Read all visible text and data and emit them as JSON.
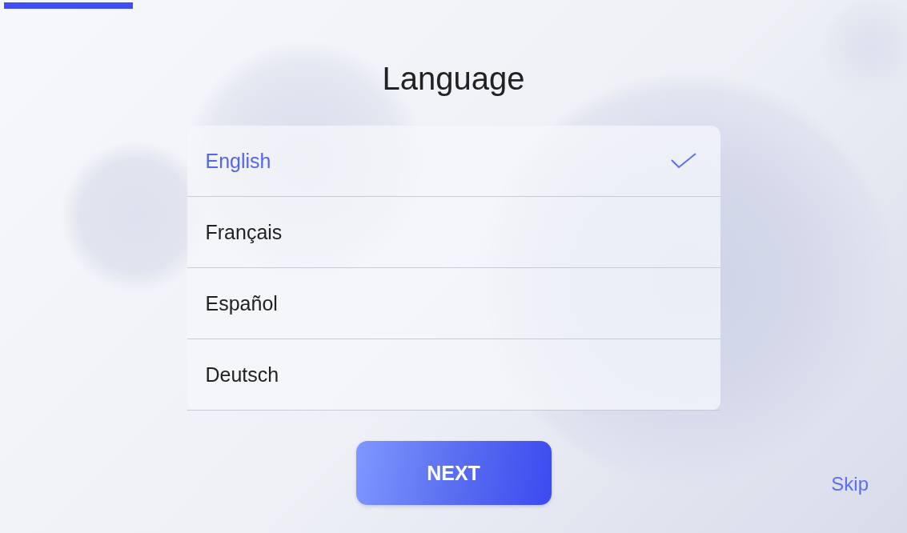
{
  "progress": {
    "level": 0.143
  },
  "title": "Language",
  "languages": [
    {
      "label": "English",
      "selected": true
    },
    {
      "label": "Français",
      "selected": false
    },
    {
      "label": "Español",
      "selected": false
    },
    {
      "label": "Deutsch",
      "selected": false
    }
  ],
  "next_button": "NEXT",
  "skip_link": "Skip"
}
